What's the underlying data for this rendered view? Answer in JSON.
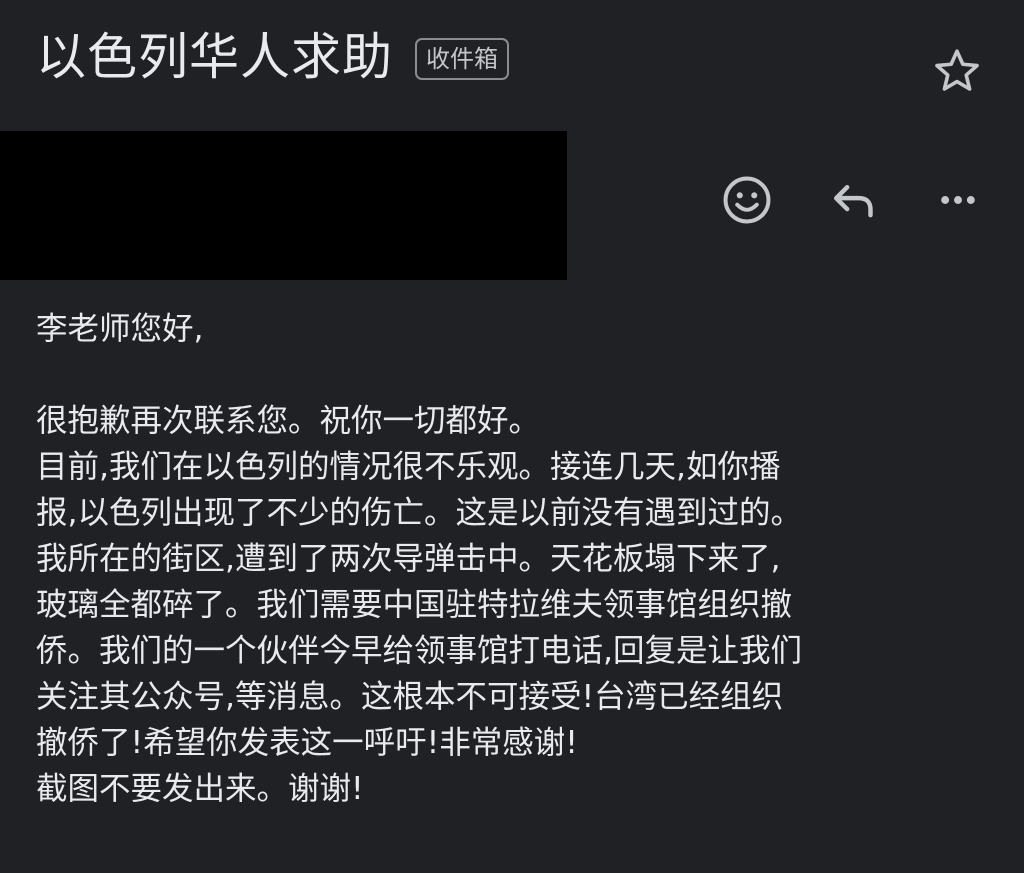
{
  "header": {
    "subject": "以色列华人求助",
    "label": "收件箱",
    "star_icon": "star-outline-icon"
  },
  "sender": {
    "redacted": true
  },
  "actions": [
    {
      "name": "emoji-reaction",
      "icon": "smiley-face-icon"
    },
    {
      "name": "reply",
      "icon": "reply-arrow-icon"
    },
    {
      "name": "more",
      "icon": "more-horizontal-icon"
    }
  ],
  "message": {
    "greeting": "李老师您好,",
    "lines": [
      "很抱歉再次联系您。祝你一切都好。",
      "目前,我们在以色列的情况很不乐观。接连几天,如你播",
      "报,以色列出现了不少的伤亡。这是以前没有遇到过的。",
      "我所在的街区,遭到了两次导弹击中。天花板塌下来了,",
      "玻璃全都碎了。我们需要中国驻特拉维夫领事馆组织撤",
      "侨。我们的一个伙伴今早给领事馆打电话,回复是让我们",
      "关注其公众号,等消息。这根本不可接受!台湾已经组织",
      "撤侨了!希望你发表这一呼吁!非常感谢!",
      "截图不要发出来。谢谢!"
    ]
  },
  "colors": {
    "background": "#202124",
    "text": "#e8eaed",
    "icon": "#c4c7c9",
    "chip_border": "#8a8c90",
    "redaction": "#000000"
  }
}
